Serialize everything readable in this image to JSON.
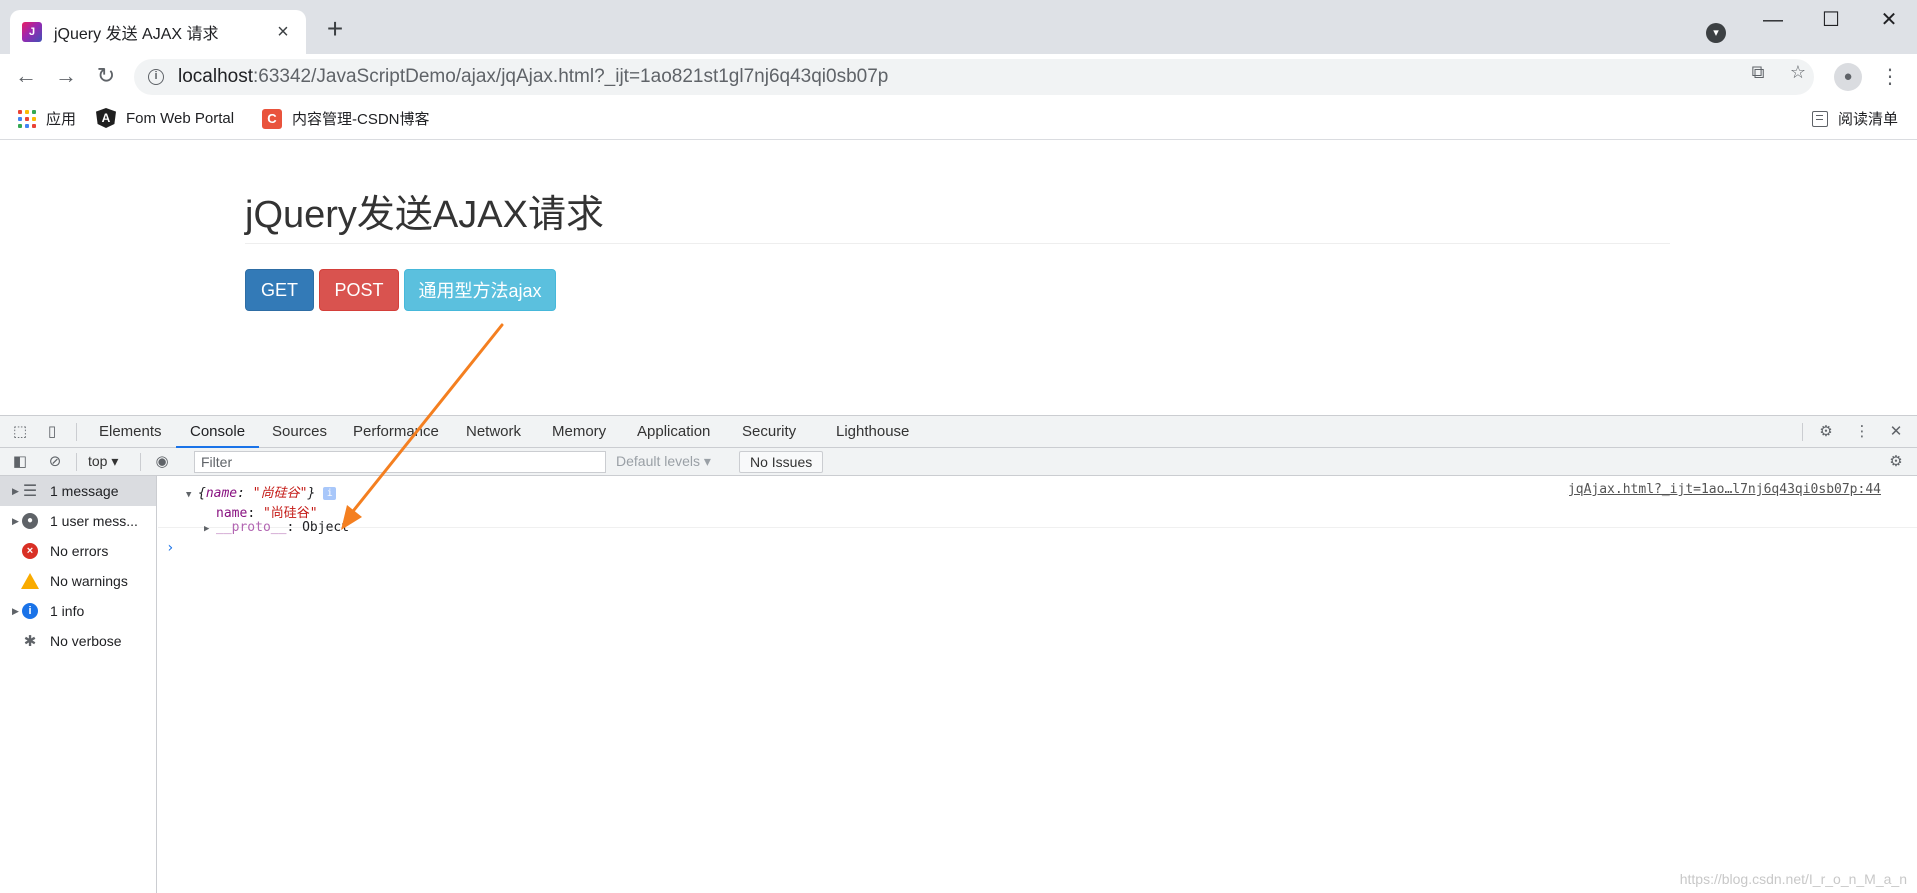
{
  "browser": {
    "tab_title": "jQuery 发送 AJAX 请求",
    "tab_favicon_text": "J",
    "tab_close": "×",
    "new_tab": "+",
    "url_host": "localhost",
    "url_rest": ":63342/JavaScriptDemo/ajax/jqAjax.html?_ijt=1ao821st1gl7nj6q43qi0sb07p",
    "bookmarks": [
      {
        "label": "应用"
      },
      {
        "label": "Fom Web Portal",
        "logo": "A"
      },
      {
        "label": "内容管理-CSDN博客",
        "logo": "C"
      }
    ],
    "reading_list": "阅读清单"
  },
  "page": {
    "title": "jQuery发送AJAX请求",
    "buttons": {
      "get": "GET",
      "post": "POST",
      "ajax": "通用型方法ajax"
    },
    "colors": {
      "get": "#337ab7",
      "post": "#d9534f",
      "ajax": "#5bc0de"
    }
  },
  "devtools": {
    "tabs": [
      "Elements",
      "Console",
      "Sources",
      "Performance",
      "Network",
      "Memory",
      "Application",
      "Security",
      "Lighthouse"
    ],
    "active_tab": "Console",
    "context": "top",
    "filter_placeholder": "Filter",
    "levels": "Default levels",
    "issues": "No Issues",
    "sidebar": [
      {
        "label": "1 message",
        "icon": "list-icon"
      },
      {
        "label": "1 user mess...",
        "icon": "user-icon"
      },
      {
        "label": "No errors",
        "icon": "error-icon"
      },
      {
        "label": "No warnings",
        "icon": "warning-icon"
      },
      {
        "label": "1 info",
        "icon": "info-icon"
      },
      {
        "label": "No verbose",
        "icon": "bug-icon"
      }
    ],
    "console": {
      "obj_open": "{",
      "obj_key": "name",
      "obj_sep": ": ",
      "obj_value": "\"尚硅谷\"",
      "obj_close": "}",
      "prop_key": "name",
      "prop_value": "\"尚硅谷\"",
      "proto_key": "__proto__",
      "proto_value": ": Object",
      "source": "jqAjax.html?_ijt=1ao…l7nj6q43qi0sb07p:44",
      "prompt": "›"
    }
  },
  "watermark": "https://blog.csdn.net/I_r_o_n_M_a_n",
  "annotation_color": "#f47f20"
}
